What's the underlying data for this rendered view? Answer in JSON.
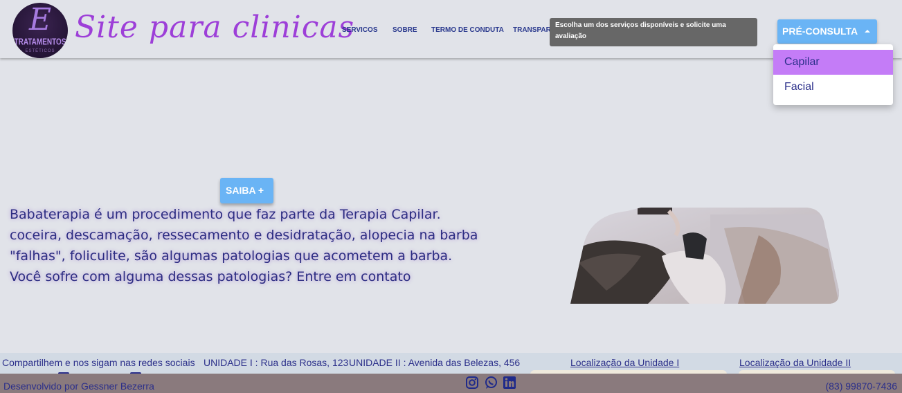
{
  "header": {
    "logo": {
      "letter": "E",
      "text": "TRATAMENTOS",
      "sub": "ESTÉTICOS"
    },
    "title": "Site para clinicas",
    "nav": {
      "servicos": "SERVICOS",
      "sobre": "SOBRE",
      "termo": "TERMO DE CONDUTA",
      "transparencia": "TRANSPARÊNCIA"
    },
    "tooltip": "Escolha um dos serviços disponíveis e solicite uma avaliação",
    "pre_consulta": {
      "label": "PRÉ-CONSULTA",
      "options": [
        "Capilar",
        "Facial"
      ],
      "highlighted": "Capilar"
    }
  },
  "hero": {
    "saiba_label": "SAIBA +",
    "text": "Babaterapia é um procedimento que faz parte da Terapia Capilar. coceira, descamação, ressecamento e desidratação, alopecia na barba \"falhas\", foliculite, são algumas patologias que acometem a barba. Você sofre com alguma dessas patologias? Entre em contato"
  },
  "footer": {
    "share": "Compartilhem e nos sigam nas redes sociais",
    "unit1": "UNIDADE I : Rua das Rosas, 123",
    "unit2": "UNIDADE II : Avenida das Belezas, 456",
    "loc1": "Localização da Unidade I",
    "loc2": "Localização da Unidade II",
    "developer": "Desenvolvido por Gessner Bezerra",
    "phone": "(83) 99870-7436",
    "social_icons": [
      "instagram-icon",
      "whatsapp-icon",
      "linkedin-icon"
    ]
  },
  "colors": {
    "background": "#e1e3e9",
    "accent_button": "#6ab4f5",
    "title_purple": "#9d3fd8",
    "nav_text": "#2b3a8e",
    "dropdown_highlight": "#c47cf7",
    "footer_bottom": "#8a7a7d"
  }
}
